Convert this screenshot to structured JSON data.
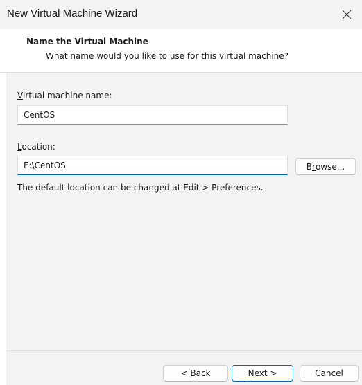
{
  "window": {
    "title": "New Virtual Machine Wizard",
    "close_icon": "close-icon"
  },
  "header": {
    "title": "Name the Virtual Machine",
    "subtitle": "What name would you like to use for this virtual machine?"
  },
  "form": {
    "vm_name": {
      "label_mnemonic": "V",
      "label_rest": "irtual machine name:",
      "value": "CentOS"
    },
    "location": {
      "label_mnemonic": "L",
      "label_rest": "ocation:",
      "value": "E:\\CentOS"
    },
    "browse_button": {
      "pre": "B",
      "mnemonic": "r",
      "post": "owse..."
    },
    "hint": "The default location can be changed at Edit > Preferences."
  },
  "footer": {
    "back_button": {
      "pre": "< ",
      "mnemonic": "B",
      "post": "ack"
    },
    "next_button": {
      "mnemonic": "N",
      "post": "ext >"
    },
    "cancel_button": {
      "label": "Cancel"
    }
  },
  "colors": {
    "accent": "#0067c0",
    "background": "#f3f3f3"
  }
}
